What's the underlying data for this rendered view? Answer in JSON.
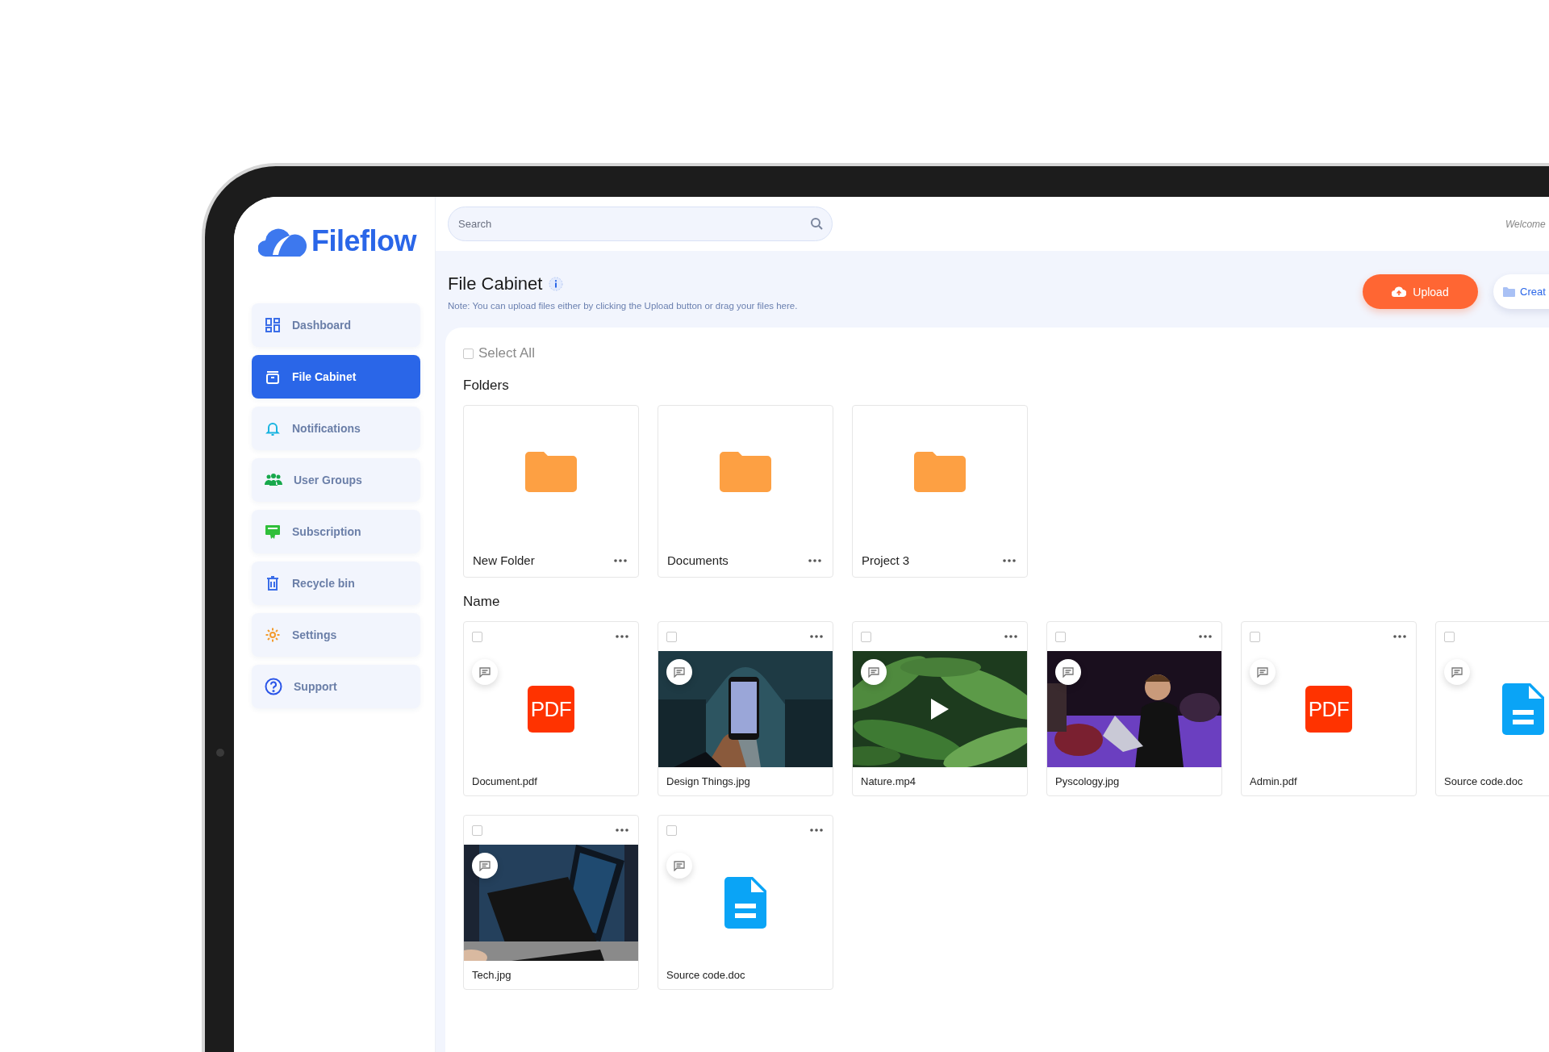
{
  "logo": {
    "text": "Fileflow"
  },
  "sidebar": {
    "items": [
      {
        "label": "Dashboard",
        "selected": false
      },
      {
        "label": "File Cabinet",
        "selected": true
      },
      {
        "label": "Notifications",
        "selected": false
      },
      {
        "label": "User Groups",
        "selected": false
      },
      {
        "label": "Subscription",
        "selected": false
      },
      {
        "label": "Recycle bin",
        "selected": false
      },
      {
        "label": "Settings",
        "selected": false
      },
      {
        "label": "Support",
        "selected": false
      }
    ]
  },
  "search": {
    "placeholder": "Search"
  },
  "welcome": "Welcome",
  "page": {
    "title": "File Cabinet",
    "note": "Note: You can upload files either by clicking the Upload button or drag your files here."
  },
  "actions": [
    {
      "label": "Upload",
      "kind": "primary"
    },
    {
      "label": "Creat",
      "kind": "secondary"
    }
  ],
  "select_all": {
    "label": "Select All",
    "checked": false
  },
  "folders": {
    "heading": "Folders",
    "items": [
      {
        "name": "New Folder"
      },
      {
        "name": "Documents"
      },
      {
        "name": "Project 3"
      }
    ]
  },
  "files": {
    "heading": "Name",
    "items": [
      {
        "name": "Document.pdf",
        "kind": "pdf",
        "badge": "PDF",
        "checked": false
      },
      {
        "name": "Design Things.jpg",
        "kind": "picture",
        "checked": false
      },
      {
        "name": "Nature.mp4",
        "kind": "video",
        "checked": false
      },
      {
        "name": "Pyscology.jpg",
        "kind": "picture",
        "checked": false
      },
      {
        "name": "Admin.pdf",
        "kind": "pdf",
        "badge": "PDF",
        "checked": false
      },
      {
        "name": "Source code.doc",
        "kind": "doc",
        "checked": false
      },
      {
        "name": "Tech.jpg",
        "kind": "picture",
        "checked": false
      },
      {
        "name": "Source code.doc",
        "kind": "doc",
        "checked": false
      }
    ]
  }
}
